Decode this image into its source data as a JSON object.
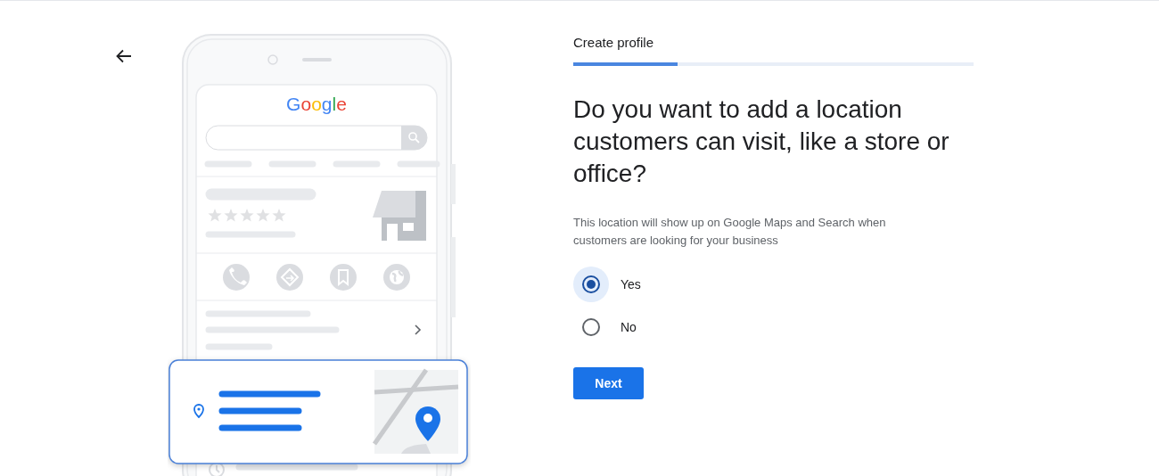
{
  "illustration": {
    "logo_text": "Google",
    "stars": 0
  },
  "progress": {
    "label": "Create profile",
    "level": 0.26
  },
  "question": "Do you want to add a location customers can visit, like a store or office?",
  "description": "This location will show up on Google Maps and Search when customers are looking for your business",
  "options": [
    {
      "label": "Yes",
      "selected": true
    },
    {
      "label": "No",
      "selected": false
    }
  ],
  "next_button": {
    "label": "Next"
  }
}
